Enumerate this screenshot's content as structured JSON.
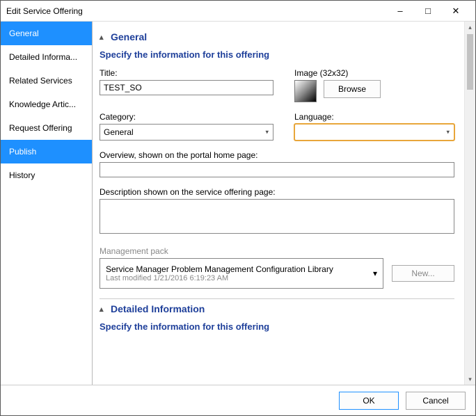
{
  "window": {
    "title": "Edit Service Offering"
  },
  "sidebar": {
    "items": [
      {
        "label": "General"
      },
      {
        "label": "Detailed Informa..."
      },
      {
        "label": "Related Services"
      },
      {
        "label": "Knowledge Artic..."
      },
      {
        "label": "Request Offering"
      },
      {
        "label": "Publish"
      },
      {
        "label": "History"
      }
    ]
  },
  "sections": {
    "general": {
      "header": "General",
      "sub": "Specify the information for this offering",
      "title_label": "Title:",
      "title_value": "TEST_SO",
      "image_label": "Image (32x32)",
      "browse": "Browse",
      "category_label": "Category:",
      "category_value": "General",
      "language_label": "Language:",
      "language_value": "",
      "overview_label": "Overview, shown on the portal home page:",
      "overview_value": "",
      "description_label": "Description shown on the service offering page:",
      "description_value": "",
      "mp_label": "Management pack",
      "mp_name": "Service Manager Problem Management Configuration Library",
      "mp_modified": "Last modified  1/21/2016 6:19:23 AM",
      "new": "New..."
    },
    "detailed": {
      "header": "Detailed Information",
      "sub": "Specify the information for this offering"
    }
  },
  "footer": {
    "ok": "OK",
    "cancel": "Cancel"
  }
}
